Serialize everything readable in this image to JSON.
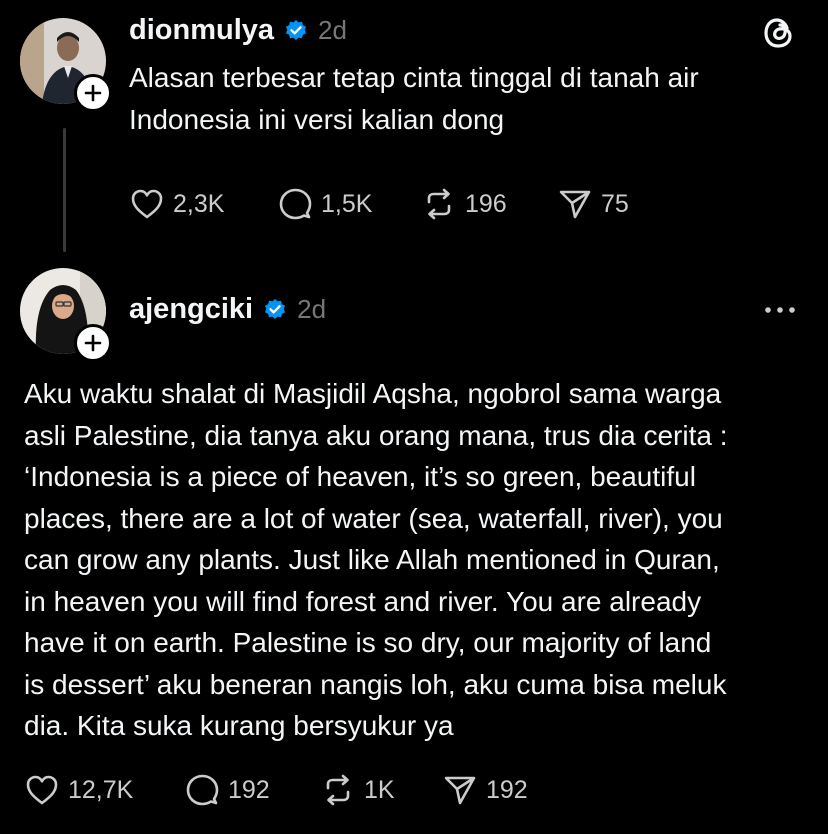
{
  "post1": {
    "username": "dionmulya",
    "time": "2d",
    "text_lines": [
      "Alasan terbesar tetap cinta tinggal di tanah air",
      "Indonesia ini versi kalian dong"
    ],
    "likes": "2,3K",
    "replies": "1,5K",
    "reposts": "196",
    "shares": "75"
  },
  "post2": {
    "username": "ajengciki",
    "time": "2d",
    "text_lines": [
      "Aku waktu shalat di Masjidil Aqsha, ngobrol sama warga",
      "asli Palestine, dia tanya aku orang mana, trus dia cerita :",
      "‘Indonesia is a piece of heaven, it’s so green, beautiful",
      "places, there are a lot of water (sea, waterfall, river), you",
      "can grow any plants. Just like Allah mentioned in Quran,",
      "in heaven you will find forest and river. You are already",
      "have it on earth. Palestine is so dry, our majority of land",
      "is dessert’ aku beneran nangis loh, aku cuma bisa meluk",
      "dia. Kita suka kurang bersyukur ya"
    ],
    "likes": "12,7K",
    "replies": "192",
    "reposts": "1K",
    "shares": "192"
  },
  "icons": {
    "app": "threads-logo-icon",
    "verified": "verified-badge-icon",
    "follow": "plus-icon",
    "like": "heart-icon",
    "reply": "speech-bubble-icon",
    "repost": "repost-icon",
    "share": "paper-plane-icon",
    "more": "more-horizontal-icon"
  },
  "colors": {
    "background": "#000000",
    "text": "#f3f5f7",
    "muted": "#777777",
    "verified": "#0095f6"
  }
}
